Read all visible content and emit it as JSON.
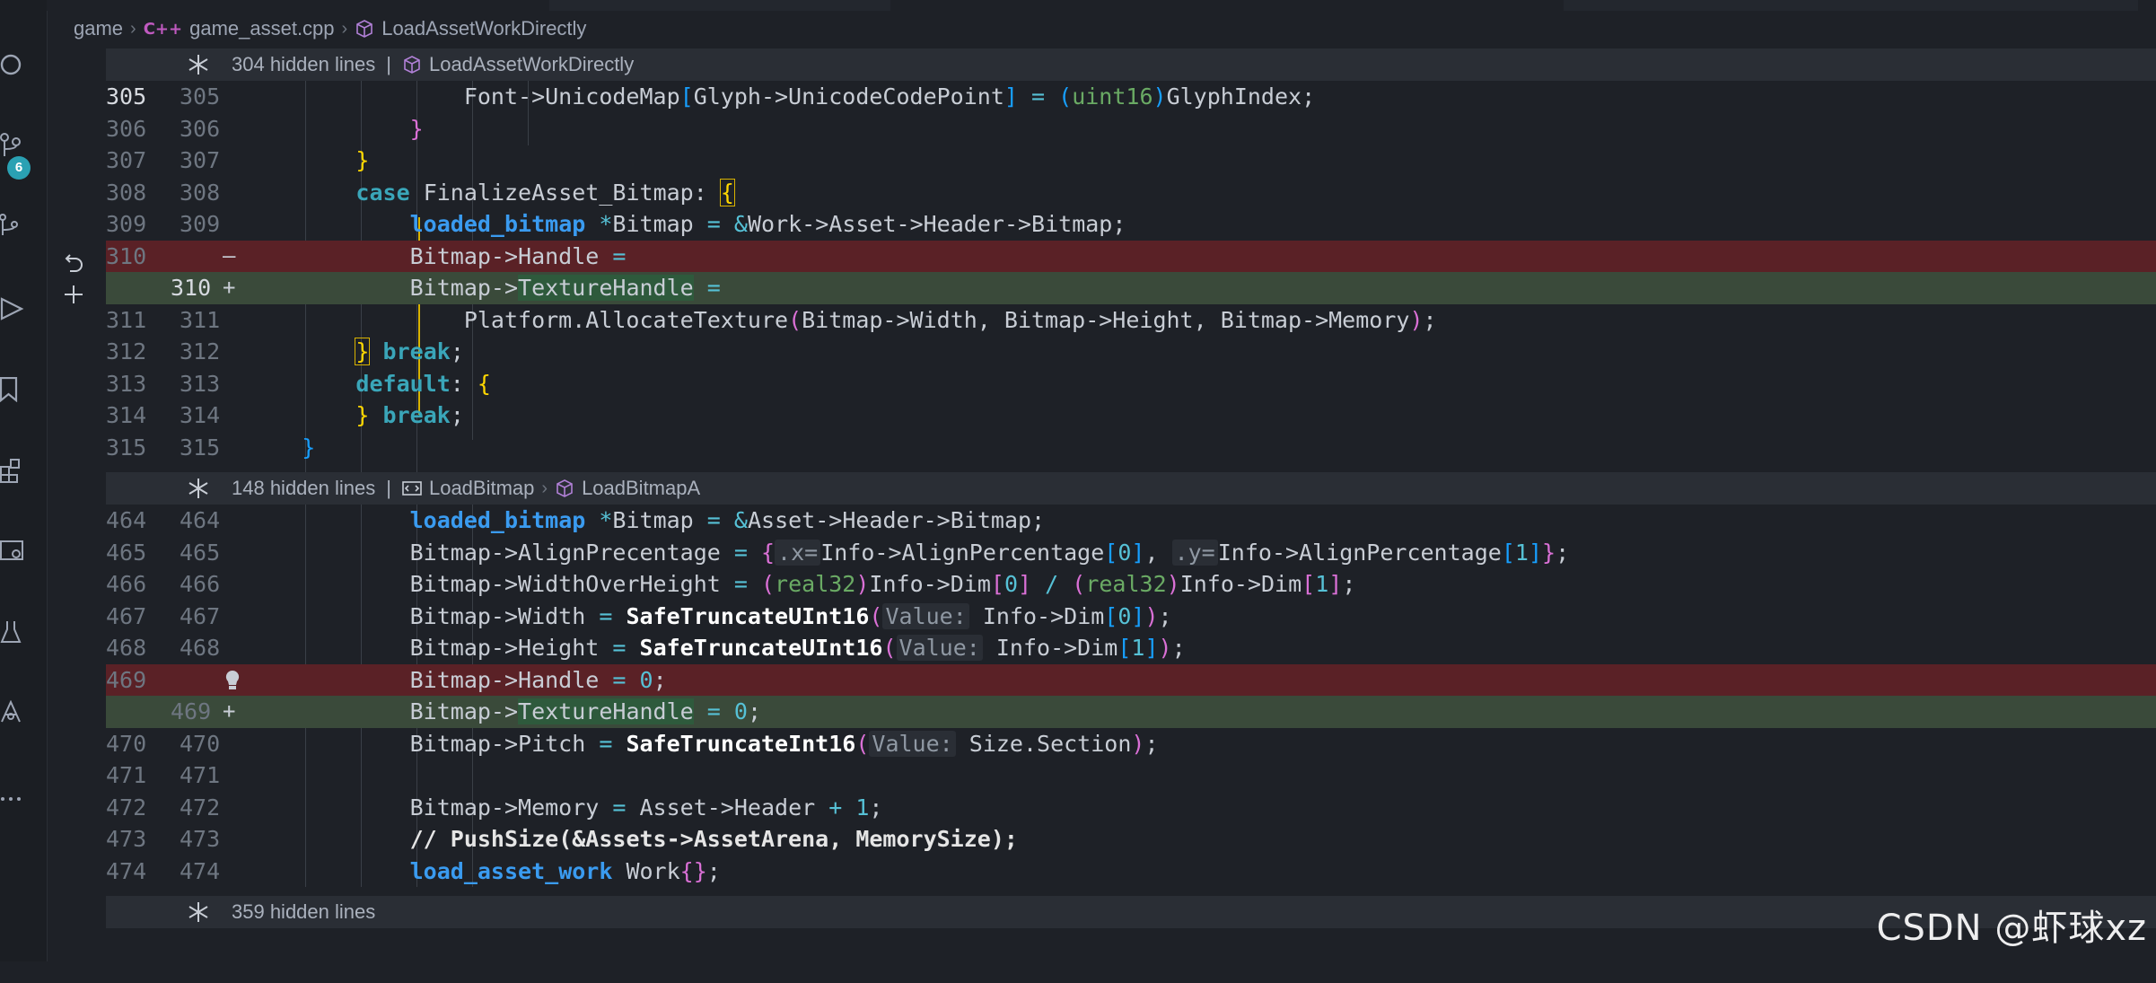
{
  "breadcrumb": {
    "folder": "game",
    "file_icon": "C++",
    "file": "game_asset.cpp",
    "symbol": "LoadAssetWorkDirectly"
  },
  "activity_bar": {
    "icons": [
      "search-icon",
      "source-control-icon",
      "source-control-graph-icon",
      "run-debug-icon",
      "bookmark-icon",
      "extensions-icon",
      "remote-explorer-icon",
      "testing-icon",
      "git-lens-icon",
      "more-icon"
    ],
    "scm_badge": "6"
  },
  "hidden_sections": [
    {
      "count_text": "304 hidden lines",
      "crumbs": [
        "LoadAssetWorkDirectly"
      ]
    },
    {
      "count_text": "148 hidden lines",
      "crumbs": [
        "LoadBitmap",
        "LoadBitmapA"
      ]
    },
    {
      "count_text": "359 hidden lines",
      "crumbs": []
    }
  ],
  "code": {
    "lines_block1": [
      {
        "old": "305",
        "new": "305"
      },
      {
        "old": "306",
        "new": "306"
      },
      {
        "old": "307",
        "new": "307"
      },
      {
        "old": "308",
        "new": "308"
      },
      {
        "old": "309",
        "new": "309"
      },
      {
        "old": "310",
        "new": "",
        "marker": "—"
      },
      {
        "old": "",
        "new": "310",
        "marker": "+"
      },
      {
        "old": "311",
        "new": "311"
      },
      {
        "old": "312",
        "new": "312"
      },
      {
        "old": "313",
        "new": "313"
      },
      {
        "old": "314",
        "new": "314"
      },
      {
        "old": "315",
        "new": "315"
      }
    ],
    "lines_block2": [
      {
        "old": "464",
        "new": "464"
      },
      {
        "old": "465",
        "new": "465"
      },
      {
        "old": "466",
        "new": "466"
      },
      {
        "old": "467",
        "new": "467"
      },
      {
        "old": "468",
        "new": "468"
      },
      {
        "old": "469",
        "new": ""
      },
      {
        "old": "",
        "new": "469",
        "marker": "+"
      },
      {
        "old": "470",
        "new": "470"
      },
      {
        "old": "471",
        "new": "471"
      },
      {
        "old": "472",
        "new": "472"
      },
      {
        "old": "473",
        "new": "473"
      },
      {
        "old": "474",
        "new": "474"
      }
    ]
  },
  "watermark": "CSDN @虾球xz",
  "colors": {
    "background": "#1e2127",
    "deleted_line": "#5a2126",
    "added_line": "#3a4a3a",
    "keyword": "#3aa6b9",
    "type": "#3a9bf0",
    "bracket_yellow": "#ffd700",
    "bracket_purple": "#da70d6",
    "bracket_blue": "#179fff"
  }
}
